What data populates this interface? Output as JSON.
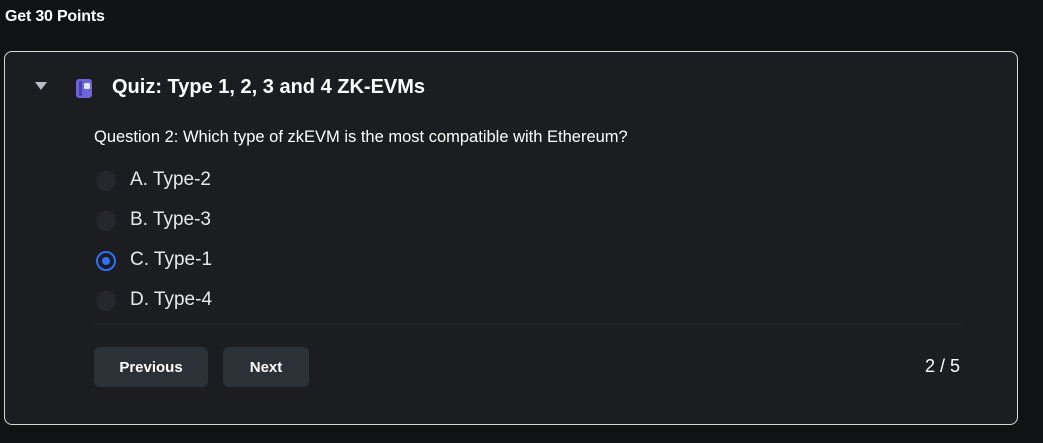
{
  "page": {
    "heading": "Get 30 Points"
  },
  "quiz": {
    "title": "Quiz: Type 1, 2, 3 and 4 ZK-EVMs",
    "icon": "book-icon",
    "toggle_icon": "caret-down-icon",
    "question": "Question 2: Which type of zkEVM is the most compatible with Ethereum?",
    "options": [
      {
        "label": "A. Type-2",
        "selected": false
      },
      {
        "label": "B. Type-3",
        "selected": false
      },
      {
        "label": "C. Type-1",
        "selected": true
      },
      {
        "label": "D. Type-4",
        "selected": false
      }
    ],
    "buttons": {
      "previous": "Previous",
      "next": "Next"
    },
    "progress": "2 / 5",
    "colors": {
      "accent": "#2f70ff",
      "card_background": "#1b1d20",
      "button_background": "#2c3037"
    }
  }
}
